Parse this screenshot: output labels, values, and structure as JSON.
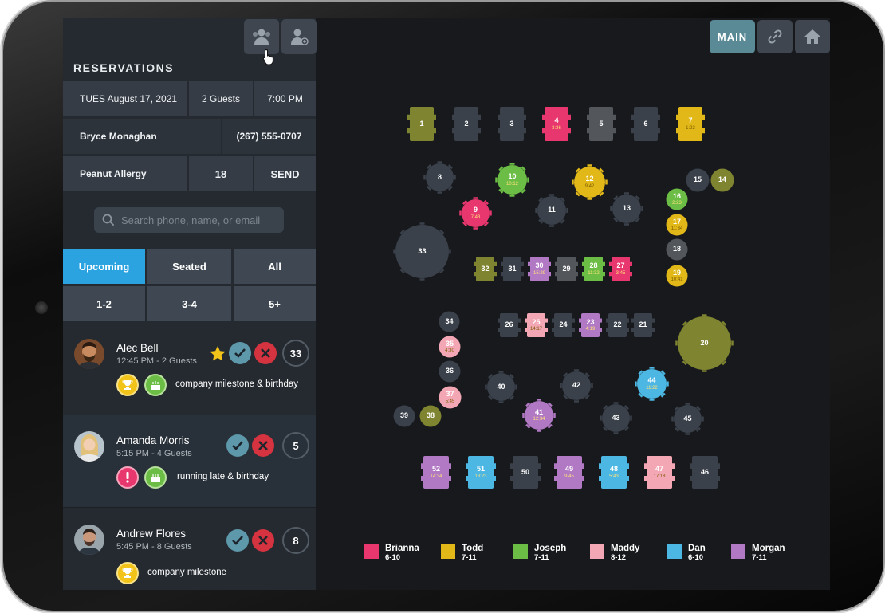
{
  "app": {
    "title": "RESERVATIONS",
    "main_label": "MAIN"
  },
  "toolbar": {
    "icons": [
      "waitlist-users-icon",
      "add-guest-icon"
    ],
    "nav_icons": [
      "link-icon",
      "home-icon"
    ]
  },
  "reservation_form": {
    "date": "TUES August 17, 2021",
    "guests": "2 Guests",
    "time": "7:00 PM",
    "name": "Bryce Monaghan",
    "phone": "(267) 555-0707",
    "note": "Peanut Allergy",
    "table": "18",
    "send_label": "SEND"
  },
  "search": {
    "placeholder": "Search phone, name, or email"
  },
  "tabs": {
    "upcoming": "Upcoming",
    "seated": "Seated",
    "all": "All"
  },
  "party_filters": {
    "small": "1-2",
    "medium": "3-4",
    "large": "5+"
  },
  "reservations": [
    {
      "name": "Alec Bell",
      "time": "12:45 PM - 2 Guests",
      "count": "33",
      "starred": true,
      "notes": "company milestone & birthday",
      "badges": [
        "trophy-icon",
        "cake-icon"
      ]
    },
    {
      "name": "Amanda Morris",
      "time": "5:15 PM - 4 Guests",
      "count": "5",
      "starred": false,
      "notes": "running late & birthday",
      "badges": [
        "alert-icon",
        "cake-icon"
      ]
    },
    {
      "name": "Andrew Flores",
      "time": "5:45  PM - 8 Guests",
      "count": "8",
      "starred": false,
      "notes": "company milestone",
      "badges": [
        "trophy-icon"
      ]
    }
  ],
  "colors": {
    "brianna": "#e8376e",
    "todd": "#e2b819",
    "joseph": "#6cbd45",
    "maddy": "#f3a6b3",
    "dan": "#4db7e3",
    "morgan": "#b178c4",
    "empty": "#3a414b",
    "olive": "#7f8430",
    "gray": "#53575c"
  },
  "tables": [
    {
      "id": "1",
      "server": "olive",
      "time": ""
    },
    {
      "id": "2",
      "server": "empty",
      "time": ""
    },
    {
      "id": "3",
      "server": "empty",
      "time": ""
    },
    {
      "id": "4",
      "server": "brianna",
      "time": "3:36"
    },
    {
      "id": "5",
      "server": "gray",
      "time": ""
    },
    {
      "id": "6",
      "server": "empty",
      "time": ""
    },
    {
      "id": "7",
      "server": "todd",
      "time": "1:23"
    },
    {
      "id": "8",
      "server": "empty",
      "time": ""
    },
    {
      "id": "9",
      "server": "brianna",
      "time": "7:43"
    },
    {
      "id": "10",
      "server": "joseph",
      "time": "10:12"
    },
    {
      "id": "11",
      "server": "empty",
      "time": ""
    },
    {
      "id": "12",
      "server": "todd",
      "time": "9:42"
    },
    {
      "id": "13",
      "server": "empty",
      "time": ""
    },
    {
      "id": "14",
      "server": "olive",
      "time": ""
    },
    {
      "id": "15",
      "server": "empty",
      "time": ""
    },
    {
      "id": "16",
      "server": "joseph",
      "time": "2:23"
    },
    {
      "id": "17",
      "server": "todd",
      "time": "11:34"
    },
    {
      "id": "18",
      "server": "gray",
      "time": ""
    },
    {
      "id": "19",
      "server": "todd",
      "time": "10:41"
    },
    {
      "id": "20",
      "server": "olive",
      "time": ""
    },
    {
      "id": "21",
      "server": "empty",
      "time": ""
    },
    {
      "id": "22",
      "server": "empty",
      "time": ""
    },
    {
      "id": "23",
      "server": "morgan",
      "time": "4:19"
    },
    {
      "id": "24",
      "server": "empty",
      "time": ""
    },
    {
      "id": "25",
      "server": "maddy",
      "time": "14:17"
    },
    {
      "id": "26",
      "server": "empty",
      "time": ""
    },
    {
      "id": "27",
      "server": "brianna",
      "time": "3:45"
    },
    {
      "id": "28",
      "server": "joseph",
      "time": "11:32"
    },
    {
      "id": "29",
      "server": "gray",
      "time": ""
    },
    {
      "id": "30",
      "server": "morgan",
      "time": "15:29"
    },
    {
      "id": "31",
      "server": "empty",
      "time": ""
    },
    {
      "id": "32",
      "server": "olive",
      "time": ""
    },
    {
      "id": "33",
      "server": "empty",
      "time": ""
    },
    {
      "id": "34",
      "server": "empty",
      "time": ""
    },
    {
      "id": "35",
      "server": "maddy",
      "time": "4:30"
    },
    {
      "id": "36",
      "server": "empty",
      "time": ""
    },
    {
      "id": "37",
      "server": "maddy",
      "time": "5:45"
    },
    {
      "id": "38",
      "server": "olive",
      "time": ""
    },
    {
      "id": "39",
      "server": "empty",
      "time": ""
    },
    {
      "id": "40",
      "server": "empty",
      "time": ""
    },
    {
      "id": "41",
      "server": "morgan",
      "time": "12:34"
    },
    {
      "id": "42",
      "server": "empty",
      "time": ""
    },
    {
      "id": "43",
      "server": "empty",
      "time": ""
    },
    {
      "id": "44",
      "server": "dan",
      "time": "11:22"
    },
    {
      "id": "45",
      "server": "empty",
      "time": ""
    },
    {
      "id": "46",
      "server": "empty",
      "time": ""
    },
    {
      "id": "47",
      "server": "maddy",
      "time": "17:18"
    },
    {
      "id": "48",
      "server": "dan",
      "time": "5:43"
    },
    {
      "id": "49",
      "server": "morgan",
      "time": "9:45"
    },
    {
      "id": "50",
      "server": "empty",
      "time": ""
    },
    {
      "id": "51",
      "server": "dan",
      "time": "18:23"
    },
    {
      "id": "52",
      "server": "morgan",
      "time": "14:34"
    }
  ],
  "legend": [
    {
      "name": "Brianna",
      "range": "6-10",
      "color": "#e8376e"
    },
    {
      "name": "Todd",
      "range": "7-11",
      "color": "#e2b819"
    },
    {
      "name": "Joseph",
      "range": "7-11",
      "color": "#6cbd45"
    },
    {
      "name": "Maddy",
      "range": "8-12",
      "color": "#f3a6b3"
    },
    {
      "name": "Dan",
      "range": "6-10",
      "color": "#4db7e3"
    },
    {
      "name": "Morgan",
      "range": "7-11",
      "color": "#b178c4"
    }
  ]
}
